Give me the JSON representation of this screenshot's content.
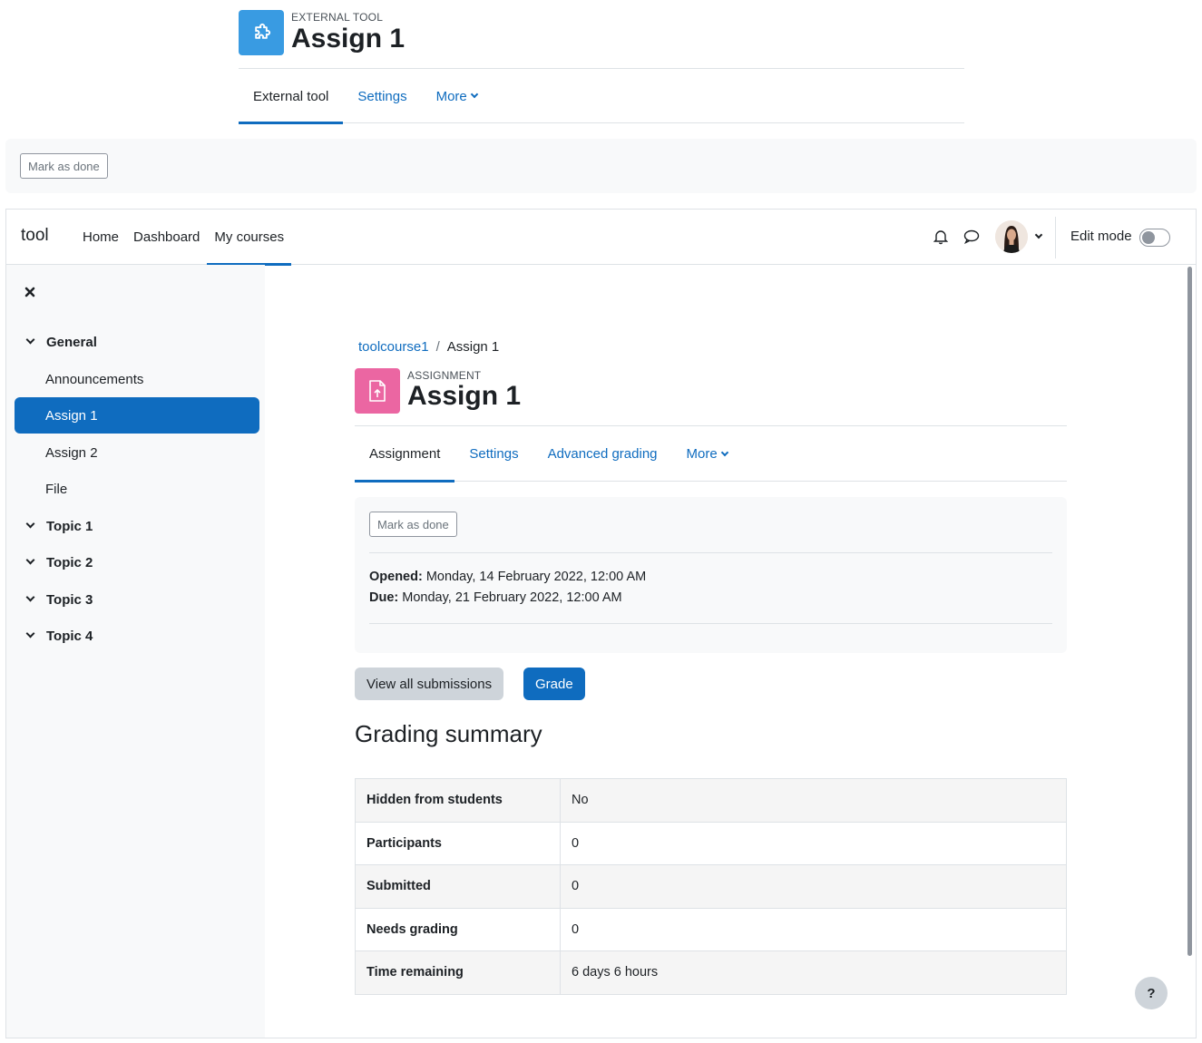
{
  "outer": {
    "purpose": "EXTERNAL TOOL",
    "title": "Assign 1",
    "tabs": [
      {
        "label": "External tool",
        "active": true
      },
      {
        "label": "Settings"
      },
      {
        "label": "More"
      }
    ],
    "mark_done": "Mark as done"
  },
  "navbar": {
    "brand": "tool",
    "links": [
      {
        "label": "Home"
      },
      {
        "label": "Dashboard"
      },
      {
        "label": "My courses",
        "active": true
      }
    ],
    "edit_mode": "Edit mode"
  },
  "drawer": {
    "items": [
      {
        "label": "General",
        "type": "section"
      },
      {
        "label": "Announcements",
        "type": "activity"
      },
      {
        "label": "Assign 1",
        "type": "activity",
        "selected": true
      },
      {
        "label": "Assign 2",
        "type": "activity"
      },
      {
        "label": "File",
        "type": "activity"
      },
      {
        "label": "Topic 1",
        "type": "section"
      },
      {
        "label": "Topic 2",
        "type": "section"
      },
      {
        "label": "Topic 3",
        "type": "section"
      },
      {
        "label": "Topic 4",
        "type": "section"
      }
    ]
  },
  "breadcrumb": {
    "course": "toolcourse1",
    "separator": "/",
    "current": "Assign 1"
  },
  "header": {
    "purpose": "ASSIGNMENT",
    "title": "Assign 1"
  },
  "tabs": [
    {
      "label": "Assignment",
      "active": true
    },
    {
      "label": "Settings"
    },
    {
      "label": "Advanced grading"
    },
    {
      "label": "More"
    }
  ],
  "activity": {
    "mark_done": "Mark as done",
    "opened_label": "Opened:",
    "opened_value": "Monday, 14 February 2022, 12:00 AM",
    "due_label": "Due:",
    "due_value": "Monday, 21 February 2022, 12:00 AM"
  },
  "actions": {
    "view_all": "View all submissions",
    "grade": "Grade"
  },
  "summary": {
    "heading": "Grading summary",
    "rows": [
      {
        "label": "Hidden from students",
        "value": "No"
      },
      {
        "label": "Participants",
        "value": "0"
      },
      {
        "label": "Submitted",
        "value": "0"
      },
      {
        "label": "Needs grading",
        "value": "0"
      },
      {
        "label": "Time remaining",
        "value": "6 days 6 hours"
      }
    ]
  },
  "help": "?",
  "colors": {
    "primary": "#0f6cbf",
    "tool_icon": "#399be2",
    "assign_icon": "#eb66a2"
  }
}
